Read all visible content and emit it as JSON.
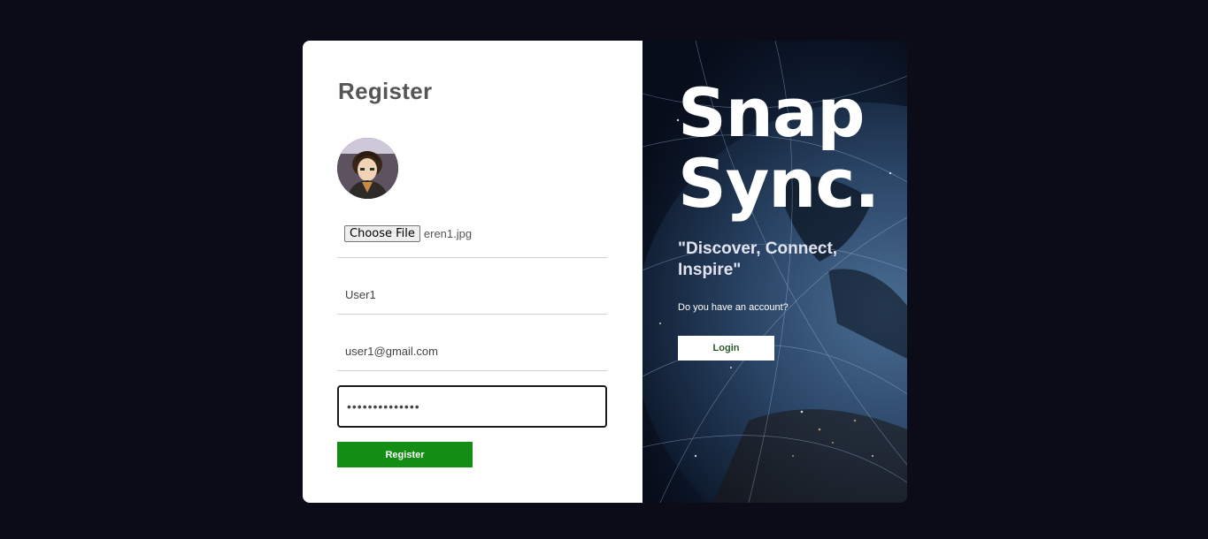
{
  "register": {
    "title": "Register",
    "file": {
      "button_label": "Choose File",
      "file_name": "eren1.jpg"
    },
    "username": {
      "value": "User1"
    },
    "email": {
      "value": "user1@gmail.com"
    },
    "password": {
      "value": "••••••••••••••"
    },
    "submit_label": "Register"
  },
  "promo": {
    "brand_line1": "Snap",
    "brand_line2": "Sync.",
    "tagline": "\"Discover, Connect, Inspire\"",
    "question": "Do you have an account?",
    "login_label": "Login"
  },
  "colors": {
    "page_bg": "#0c0b18",
    "register_button": "#138d13",
    "login_text": "#2b5a2b"
  },
  "icons": [
    "avatar-image",
    "globe-background"
  ]
}
